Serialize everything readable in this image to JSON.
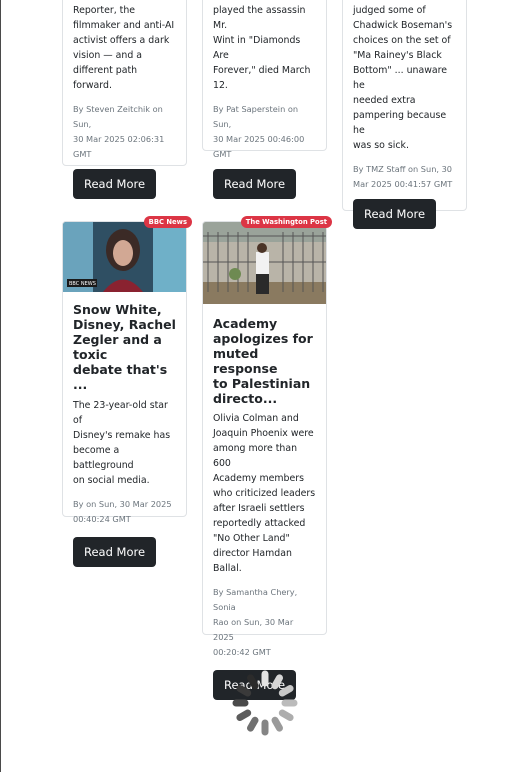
{
  "cards_top": [
    {
      "desc_lines": [
        "Reporter, the",
        "filmmaker and anti-AI",
        "activist offers a dark",
        "vision —  and a",
        "different path forward."
      ],
      "meta_lines": [
        "By Steven Zeitchik on Sun,",
        "30 Mar 2025 02:06:31 GMT"
      ],
      "button": "Read More"
    },
    {
      "desc_lines": [
        "played the assassin Mr.",
        "Wint in \"Diamonds Are",
        "Forever,\" died March",
        "12."
      ],
      "meta_lines": [
        "By Pat Saperstein on Sun,",
        "30 Mar 2025 00:46:00 GMT"
      ],
      "button": "Read More"
    },
    {
      "desc_lines": [
        "judged some of",
        "Chadwick Boseman's",
        "choices on the set of",
        "\"Ma Rainey's Black",
        "Bottom\" ... unaware he",
        "needed extra",
        "pampering because he",
        "was so sick."
      ],
      "meta_lines": [
        "By TMZ Staff on Sun, 30",
        "Mar 2025 00:41:57 GMT"
      ],
      "button": "Read More"
    }
  ],
  "cards_bottom": [
    {
      "badge": "BBC News",
      "thumb_caption": "BBC NEWS",
      "title_lines": [
        "Snow White,",
        "Disney, Rachel",
        "Zegler and a toxic",
        "debate that's ..."
      ],
      "desc_lines": [
        "The 23-year-old star of",
        "Disney's remake has",
        "become a battleground",
        "on social media."
      ],
      "meta_lines": [
        "By  on Sun, 30 Mar 2025",
        "00:40:24 GMT"
      ],
      "button": "Read More"
    },
    {
      "badge": "The Washington Post",
      "title_lines": [
        "Academy",
        "apologizes for",
        "muted response",
        "to Palestinian",
        "directo..."
      ],
      "desc_lines": [
        "Olivia Colman and",
        "Joaquin Phoenix were",
        "among more than 600",
        "Academy members",
        "who criticized leaders",
        "after Israeli settlers",
        "reportedly attacked",
        "\"No Other Land\"",
        "director Hamdan Ballal."
      ],
      "meta_lines": [
        "By Samantha Chery, Sonia",
        "Rao on Sun, 30 Mar 2025",
        "00:20:42 GMT"
      ],
      "button": "Read More"
    }
  ],
  "colors": {
    "button_bg": "#212529",
    "badge_bg": "#dc3545",
    "meta": "#6c757d"
  },
  "spinner_icon": "loading-spinner-icon"
}
